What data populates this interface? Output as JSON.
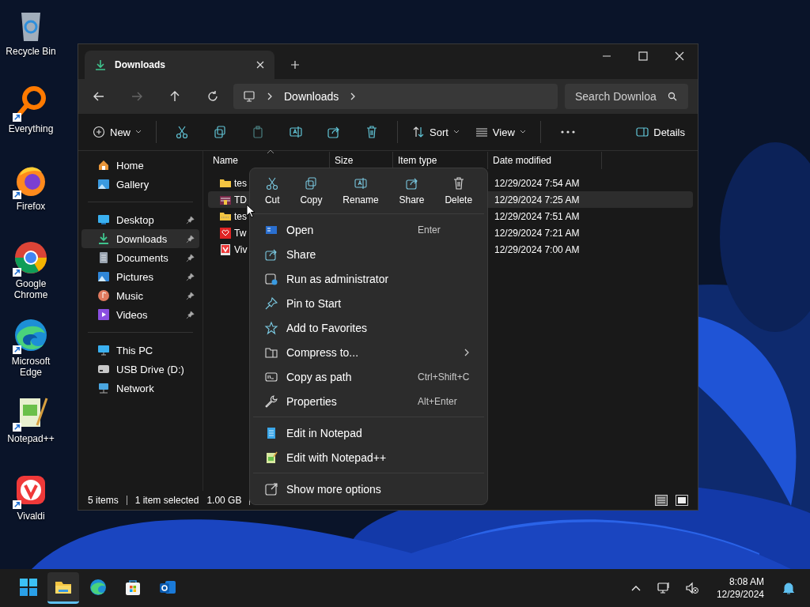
{
  "desktop_icons": [
    {
      "label": "Recycle Bin",
      "kind": "bin",
      "shortcut": false
    },
    {
      "label": "Everything",
      "kind": "ring",
      "shortcut": true
    },
    {
      "label": "Firefox",
      "kind": "fox",
      "shortcut": true
    },
    {
      "label": "Google Chrome",
      "kind": "chrome",
      "shortcut": true
    },
    {
      "label": "Microsoft Edge",
      "kind": "wave",
      "shortcut": true
    },
    {
      "label": "Notepad++",
      "kind": "notepad",
      "shortcut": true
    },
    {
      "label": "Vivaldi",
      "kind": "vivaldi",
      "shortcut": true
    }
  ],
  "window": {
    "tab": {
      "title": "Downloads"
    },
    "address": {
      "crumb": "Downloads"
    },
    "search": {
      "placeholder": "Search Downloa"
    },
    "toolbar": {
      "new_label": "New",
      "actions": [
        {
          "kind": "cut",
          "disabled": false
        },
        {
          "kind": "copy",
          "disabled": false
        },
        {
          "kind": "paste",
          "disabled": true
        },
        {
          "kind": "rename",
          "disabled": false
        },
        {
          "kind": "share",
          "disabled": false
        },
        {
          "kind": "delete",
          "disabled": false
        }
      ],
      "sort_label": "Sort",
      "view_label": "View",
      "details_label": "Details"
    },
    "sidebar": {
      "groups": [
        [
          {
            "label": "Home",
            "kind": "home",
            "pinned": false,
            "selected": false
          },
          {
            "label": "Gallery",
            "kind": "gallery",
            "pinned": false,
            "selected": false
          }
        ],
        [
          {
            "label": "Desktop",
            "kind": "desktop",
            "pinned": true,
            "selected": false
          },
          {
            "label": "Downloads",
            "kind": "download",
            "pinned": true,
            "selected": true
          },
          {
            "label": "Documents",
            "kind": "document",
            "pinned": true,
            "selected": false
          },
          {
            "label": "Pictures",
            "kind": "pictures",
            "pinned": true,
            "selected": false
          },
          {
            "label": "Music",
            "kind": "music",
            "pinned": true,
            "selected": false
          },
          {
            "label": "Videos",
            "kind": "videos",
            "pinned": true,
            "selected": false
          }
        ],
        [
          {
            "label": "This PC",
            "kind": "pc",
            "pinned": false,
            "selected": false
          },
          {
            "label": "USB Drive (D:)",
            "kind": "drive",
            "pinned": false,
            "selected": false
          },
          {
            "label": "Network",
            "kind": "network",
            "pinned": false,
            "selected": false
          }
        ]
      ]
    },
    "table": {
      "columns": [
        "Name",
        "Size",
        "Item type",
        "Date modified"
      ],
      "rows": [
        {
          "name": "tes",
          "kind": "folder",
          "date": "12/29/2024 7:54 AM",
          "selected": false
        },
        {
          "name": "TD",
          "kind": "installer",
          "date": "12/29/2024 7:25 AM",
          "selected": true
        },
        {
          "name": "tes",
          "kind": "zip",
          "date": "12/29/2024 7:51 AM",
          "selected": false
        },
        {
          "name": "Tw",
          "kind": "redapp",
          "date": "12/29/2024 7:21 AM",
          "selected": false
        },
        {
          "name": "Viv",
          "kind": "vivaldi",
          "date": "12/29/2024 7:00 AM",
          "selected": false
        }
      ]
    },
    "status_bar": {
      "count": "5 items",
      "selection": "1 item selected",
      "size": "1.00 GB",
      "views": [
        {
          "kind": "details",
          "selected": true
        },
        {
          "kind": "tiles",
          "selected": false
        }
      ]
    }
  },
  "context_menu": {
    "actions": [
      {
        "label": "Cut",
        "kind": "cut"
      },
      {
        "label": "Copy",
        "kind": "copy"
      },
      {
        "label": "Rename",
        "kind": "rename"
      },
      {
        "label": "Share",
        "kind": "share"
      },
      {
        "label": "Delete",
        "kind": "delete"
      }
    ],
    "groups": [
      [
        {
          "label": "Open",
          "kind": "open",
          "shortcut": "Enter",
          "submenu": false
        },
        {
          "label": "Share",
          "kind": "share",
          "submenu": false
        },
        {
          "label": "Run as administrator",
          "kind": "admin",
          "submenu": false
        },
        {
          "label": "Pin to Start",
          "kind": "pin",
          "submenu": false
        },
        {
          "label": "Add to Favorites",
          "kind": "star",
          "submenu": false
        },
        {
          "label": "Compress to...",
          "kind": "compress",
          "submenu": true
        },
        {
          "label": "Copy as path",
          "kind": "path",
          "shortcut": "Ctrl+Shift+C",
          "submenu": false
        },
        {
          "label": "Properties",
          "kind": "wrench",
          "shortcut": "Alt+Enter",
          "submenu": false
        }
      ],
      [
        {
          "label": "Edit in Notepad",
          "kind": "notepad",
          "submenu": false
        },
        {
          "label": "Edit with Notepad++",
          "kind": "notepadpp",
          "submenu": false
        }
      ],
      [
        {
          "label": "Show more options",
          "kind": "more",
          "submenu": false
        }
      ]
    ]
  },
  "taskbar": {
    "apps": [
      {
        "kind": "start",
        "active": false
      },
      {
        "kind": "explorer",
        "active": true
      },
      {
        "kind": "edge",
        "active": false
      },
      {
        "kind": "store",
        "active": false
      },
      {
        "kind": "outlook",
        "active": false
      }
    ],
    "time": "8:08 AM",
    "date": "12/29/2024"
  }
}
